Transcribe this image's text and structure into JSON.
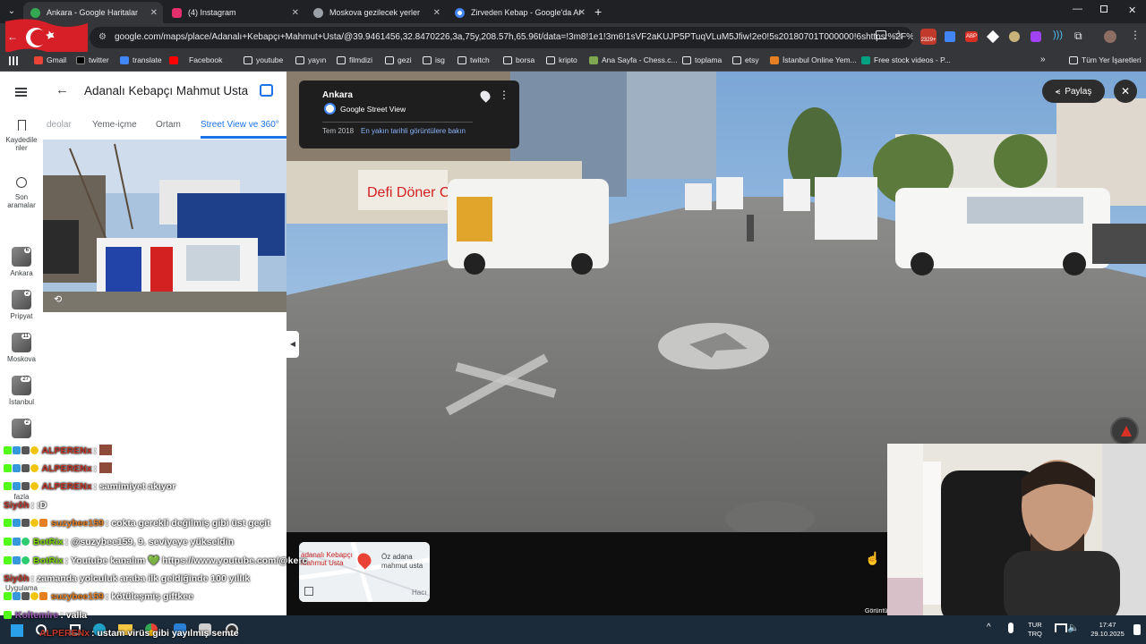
{
  "tabs": [
    {
      "title": "Ankara - Google Haritalar",
      "active": true,
      "favicon_color": "#34a853"
    },
    {
      "title": "(4) Instagram",
      "active": false,
      "favicon_color": "#e1306c"
    },
    {
      "title": "Moskova gezilecek yerler",
      "active": false,
      "favicon_color": "#9aa0a6"
    },
    {
      "title": "Zirveden Kebap - Google'da Ar",
      "active": false,
      "favicon_color": "#4285f4"
    }
  ],
  "new_tab_icon": "plus-icon",
  "address_bar": {
    "url": "google.com/maps/place/Adanalı+Kebapçı+Mahmut+Usta/@39.9461456,32.8470226,3a,75y,208.57h,65.96t/data=!3m8!1e1!3m6!1sVF2aKUJP5PTuqVLuM5Jfiw!2e0!5s20180701T000000!6shttps:%2F%2Fstr..."
  },
  "extension_badge": "2329+",
  "bookmarks": [
    {
      "label": "Gmail",
      "icon": "gmail-icon"
    },
    {
      "label": "twitter",
      "icon": "x-icon"
    },
    {
      "label": "translate",
      "icon": "translate-icon"
    },
    {
      "label": "Facebook",
      "icon": "youtube-icon"
    },
    {
      "label": "youtube",
      "icon": "folder-icon"
    },
    {
      "label": "yayın",
      "icon": "folder-icon"
    },
    {
      "label": "filmdizi",
      "icon": "folder-icon"
    },
    {
      "label": "gezi",
      "icon": "folder-icon"
    },
    {
      "label": "isg",
      "icon": "folder-icon"
    },
    {
      "label": "twitch",
      "icon": "folder-icon"
    },
    {
      "label": "borsa",
      "icon": "folder-icon"
    },
    {
      "label": "kripto",
      "icon": "folder-icon"
    },
    {
      "label": "Ana Sayfa - Chess.c...",
      "icon": "chess-icon"
    },
    {
      "label": "toplama",
      "icon": "folder-icon"
    },
    {
      "label": "etsy",
      "icon": "folder-icon"
    },
    {
      "label": "İstanbul Online Yem...",
      "icon": "fork-icon"
    },
    {
      "label": "Free stock videos - P...",
      "icon": "pexels-icon"
    }
  ],
  "all_bookmarks": "Tüm Yer İşaretleri",
  "rail": {
    "saved": "Kaydedilenler",
    "saved_line1": "Kaydedile",
    "saved_line2": "nler",
    "recent_line1": "Son",
    "recent_line2": "aramalar",
    "items": [
      {
        "label": "Ankara",
        "count": "6"
      },
      {
        "label": "Pripyat",
        "count": "2"
      },
      {
        "label": "Moskova",
        "count": "11"
      },
      {
        "label": "İstanbul",
        "count": "27"
      },
      {
        "label": "",
        "count": "2"
      }
    ],
    "more": "fazla",
    "apps": "Uygulama"
  },
  "panel": {
    "title": "Adanalı Kebapçı Mahmut Usta",
    "tabs": [
      "deolar",
      "Yeme-içme",
      "Ortam",
      "Street View ve 360°"
    ],
    "active_tab": "Street View ve 360°"
  },
  "chat": [
    {
      "nick": "ALPERENx",
      "nick_color": "#c0392b",
      "text": ""
    },
    {
      "nick": "ALPERENx",
      "nick_color": "#c0392b",
      "text": ""
    },
    {
      "nick": "ALPERENx",
      "nick_color": "#c0392b",
      "text": "samimiyet akıyor"
    },
    {
      "nick": "Siyôh",
      "nick_color": "#c0392b",
      "text": ":D"
    },
    {
      "nick": "suzybee159",
      "nick_color": "#e67e22",
      "text": "cokta gerekli değilmiş gibi üst geçit"
    },
    {
      "nick": "BotRix",
      "nick_color": "#7bd600",
      "text": "@suzybee159, 9. seviyeye yükseldin"
    },
    {
      "nick": "BotRix",
      "nick_color": "#7bd600",
      "text": "Youtube kanalım 💚 https://www.youtube.com/@kerc"
    },
    {
      "nick": "Siyôh",
      "nick_color": "#c0392b",
      "text": "zamanda yolculuk araba ilk geldiğinde 100 yıllık"
    },
    {
      "nick": "suzybee159",
      "nick_color": "#e67e22",
      "text": "kötüleşmiş giftkee"
    },
    {
      "nick": "Koltemire",
      "nick_color": "#9b59b6",
      "text": "valla"
    },
    {
      "nick": "ALPERENx",
      "nick_color": "#c0392b",
      "text": "ustam virüs gibi yayılmış semte"
    }
  ],
  "street_view": {
    "location": "Ankara",
    "provider": "Google Street View",
    "date": "Tem 2018",
    "newer_link": "En yakın tarihli görüntülere bakın",
    "share": "Paylaş",
    "minimap_label": "Öz adana mahmut usta",
    "minimap_label2": "adanalı Kebapçı Mahmut Usta",
    "minimap_corner": "Hacı",
    "signage_text": "Defi Döner Cafe",
    "watermark": "Görüntü"
  },
  "taskbar": {
    "lang1": "TUR",
    "lang2": "TRQ",
    "time": "17:47",
    "date": "29.10.2025"
  }
}
